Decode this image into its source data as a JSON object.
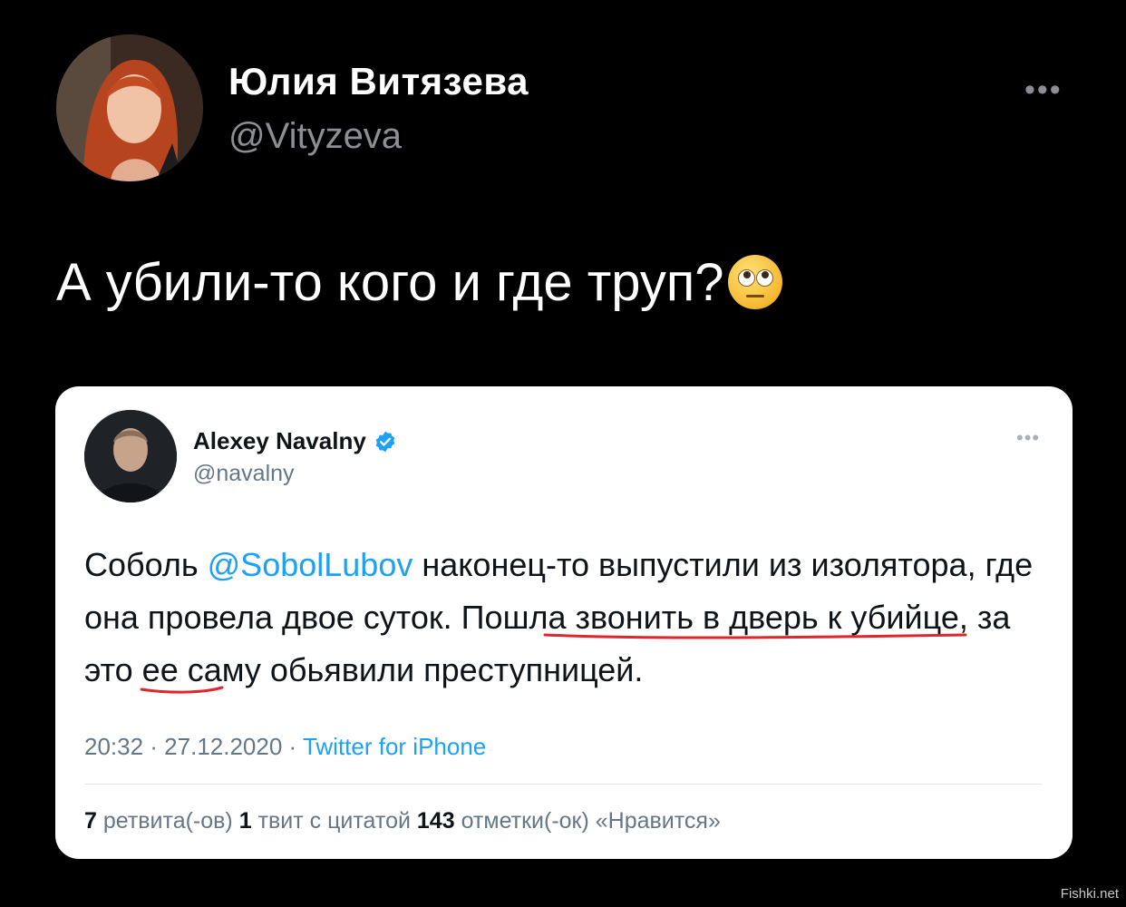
{
  "author": {
    "name": "Юлия Витязева",
    "handle": "@Vityzeva"
  },
  "tweet": {
    "text": "А убили-то кого и где труп?",
    "emoji_icon": "face-with-rolling-eyes-icon"
  },
  "quoted": {
    "name": "Alexey Navalny",
    "handle": "@navalny",
    "body_part1": "Соболь ",
    "mention": "@SobolLubov",
    "body_part2": " наконец-то выпустили из изолятора, где она провела двое суток. Пошла звонить в дверь к убийце, за это ее саму обьявили преступницей.",
    "time": "20:32 · 27.12.2020 · ",
    "source": "Twitter for iPhone",
    "retweets_count": "7",
    "retweets_label": " ретвита(-ов)  ",
    "quotes_count": "1",
    "quotes_label": " твит с цитатой  ",
    "likes_count": "143",
    "likes_label": " отметки(-ок) «Нравится»",
    "accent_color": "#1da1f2",
    "underline_color": "#e0262b"
  },
  "watermark": "Fishki.net"
}
